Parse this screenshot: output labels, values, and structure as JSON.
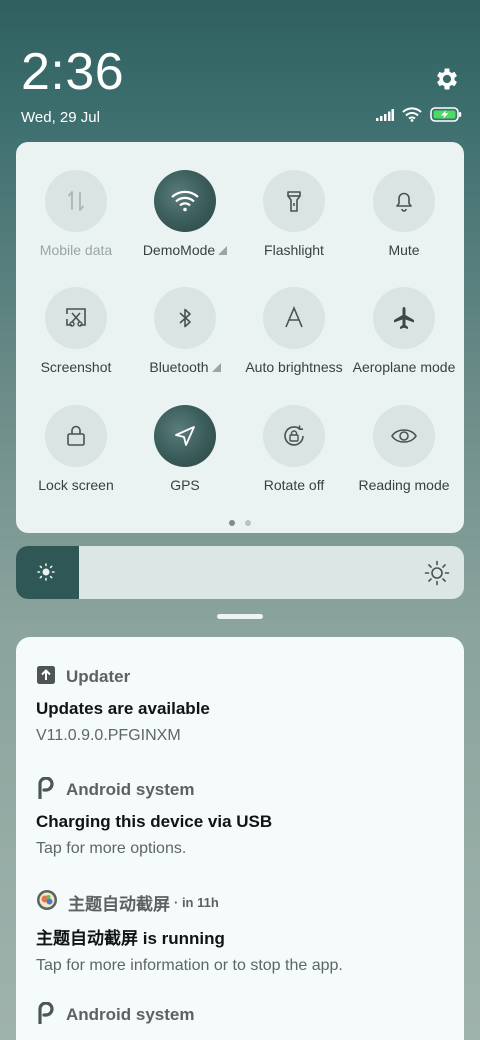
{
  "status": {
    "time": "2:36",
    "date": "Wed, 29 Jul",
    "icons": [
      "signal-icon",
      "wifi-icon",
      "battery-charging-icon"
    ]
  },
  "quick_settings": {
    "tiles": [
      {
        "label": "Mobile data",
        "icon": "mobile-data-icon",
        "active": false,
        "dim": true,
        "has_menu": false
      },
      {
        "label": "DemoMode",
        "icon": "wifi-icon",
        "active": true,
        "dim": false,
        "has_menu": true
      },
      {
        "label": "Flashlight",
        "icon": "flashlight-icon",
        "active": false,
        "dim": false,
        "has_menu": false
      },
      {
        "label": "Mute",
        "icon": "bell-icon",
        "active": false,
        "dim": false,
        "has_menu": false
      },
      {
        "label": "Screenshot",
        "icon": "screenshot-icon",
        "active": false,
        "dim": false,
        "has_menu": false
      },
      {
        "label": "Bluetooth",
        "icon": "bluetooth-icon",
        "active": false,
        "dim": false,
        "has_menu": true
      },
      {
        "label": "Auto brightness",
        "icon": "auto-brightness-icon",
        "active": false,
        "dim": false,
        "has_menu": false
      },
      {
        "label": "Aeroplane mode",
        "icon": "aeroplane-icon",
        "active": false,
        "dim": false,
        "has_menu": false
      },
      {
        "label": "Lock screen",
        "icon": "lock-icon",
        "active": false,
        "dim": false,
        "has_menu": false
      },
      {
        "label": "GPS",
        "icon": "gps-icon",
        "active": true,
        "dim": false,
        "has_menu": false
      },
      {
        "label": "Rotate off",
        "icon": "rotate-lock-icon",
        "active": false,
        "dim": false,
        "has_menu": false
      },
      {
        "label": "Reading mode",
        "icon": "eye-icon",
        "active": false,
        "dim": false,
        "has_menu": false
      }
    ],
    "page_count": 2,
    "current_page": 1
  },
  "brightness": {
    "level_fraction": 0.14
  },
  "notifications": [
    {
      "app": "Updater",
      "icon": "updater-icon",
      "time": "",
      "title": "Updates are available",
      "text": "V11.0.9.0.PFGINXM"
    },
    {
      "app": "Android system",
      "icon": "android-system-icon",
      "time": "",
      "title": "Charging this device via USB",
      "text": "Tap for more options."
    },
    {
      "app": "主题自动截屏",
      "icon": "theme-app-icon",
      "time": "· in 11h",
      "title": "主题自动截屏 is running",
      "text": "Tap for more information or to stop the app."
    },
    {
      "app": "Android system",
      "icon": "android-system-icon",
      "time": "",
      "title": "",
      "text": ""
    }
  ],
  "colors": {
    "accent_dark": "#2f5756",
    "panel_bg": "#eaf3f2",
    "charging_green": "#4cd964"
  }
}
